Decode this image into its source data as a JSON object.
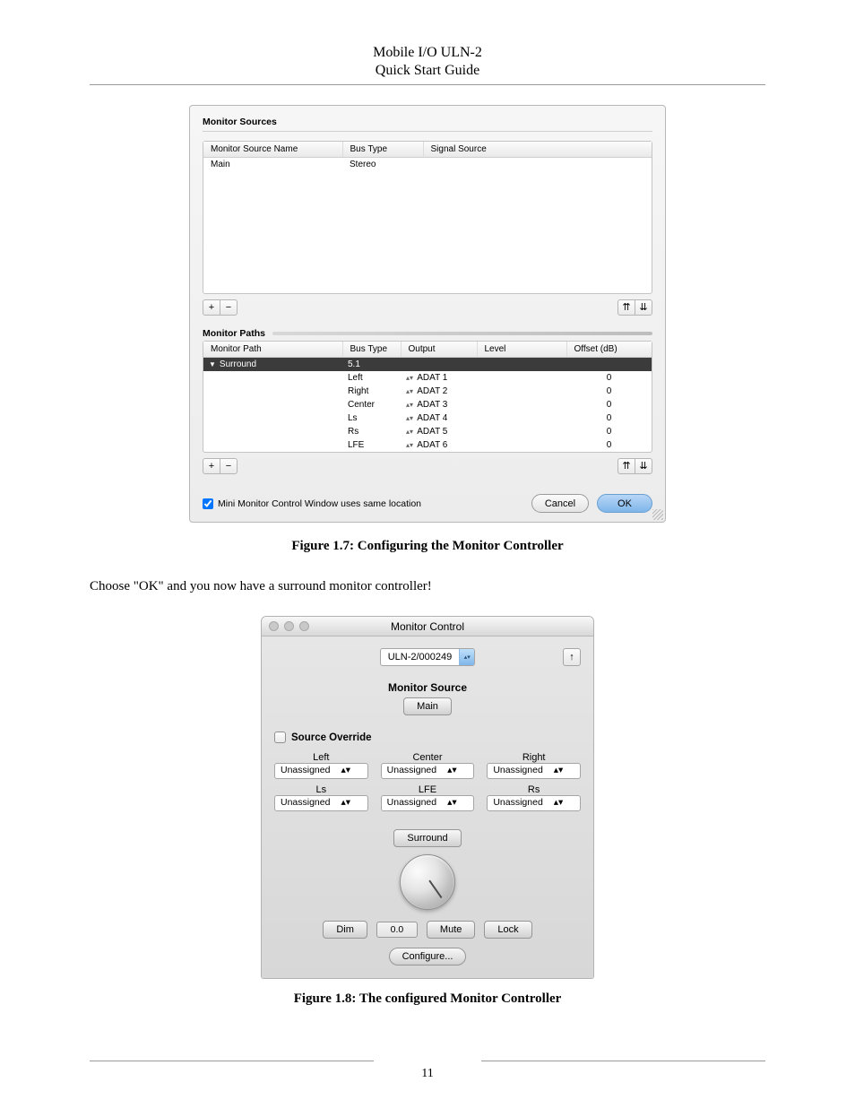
{
  "doc": {
    "title1": "Mobile I/O ULN-2",
    "title2": "Quick Start Guide",
    "pageNumber": "11"
  },
  "fig1": {
    "sourcesLabel": "Monitor Sources",
    "pathsLabel": "Monitor Paths",
    "sourcesHeaders": [
      "Monitor Source Name",
      "Bus Type",
      "Signal Source"
    ],
    "sourcesRows": [
      {
        "name": "Main",
        "bus": "Stereo",
        "sig": ""
      }
    ],
    "pathsHeaders": [
      "Monitor Path",
      "Bus Type",
      "Output",
      "Level",
      "Offset (dB)"
    ],
    "pathSelected": {
      "name": "Surround",
      "bus": "5.1"
    },
    "pathRows": [
      {
        "bus": "Left",
        "out": "ADAT 1",
        "level": "",
        "offset": "0"
      },
      {
        "bus": "Right",
        "out": "ADAT 2",
        "level": "",
        "offset": "0"
      },
      {
        "bus": "Center",
        "out": "ADAT 3",
        "level": "",
        "offset": "0"
      },
      {
        "bus": "Ls",
        "out": "ADAT 4",
        "level": "",
        "offset": "0"
      },
      {
        "bus": "Rs",
        "out": "ADAT 5",
        "level": "",
        "offset": "0"
      },
      {
        "bus": "LFE",
        "out": "ADAT 6",
        "level": "",
        "offset": "0"
      }
    ],
    "add": "+",
    "remove": "−",
    "top": "⇈",
    "bottom": "⇊",
    "checkboxLabel": "Mini Monitor Control Window uses same location",
    "cancel": "Cancel",
    "ok": "OK",
    "caption": "Figure 1.7: Configuring the Monitor Controller"
  },
  "bodyText": "Choose \"OK\" and you now have a surround monitor controller!",
  "fig2": {
    "title": "Monitor Control",
    "device": "ULN-2/000249",
    "pin": "↑",
    "sourceTitle": "Monitor Source",
    "sourceBtn": "Main",
    "sourceOverride": "Source Override",
    "channels": [
      {
        "label": "Left",
        "value": "Unassigned"
      },
      {
        "label": "Center",
        "value": "Unassigned"
      },
      {
        "label": "Right",
        "value": "Unassigned"
      },
      {
        "label": "Ls",
        "value": "Unassigned"
      },
      {
        "label": "LFE",
        "value": "Unassigned"
      },
      {
        "label": "Rs",
        "value": "Unassigned"
      }
    ],
    "pathBtn": "Surround",
    "dim": "Dim",
    "level": "0.0",
    "mute": "Mute",
    "lock": "Lock",
    "configure": "Configure...",
    "caption": "Figure 1.8: The configured Monitor Controller"
  }
}
